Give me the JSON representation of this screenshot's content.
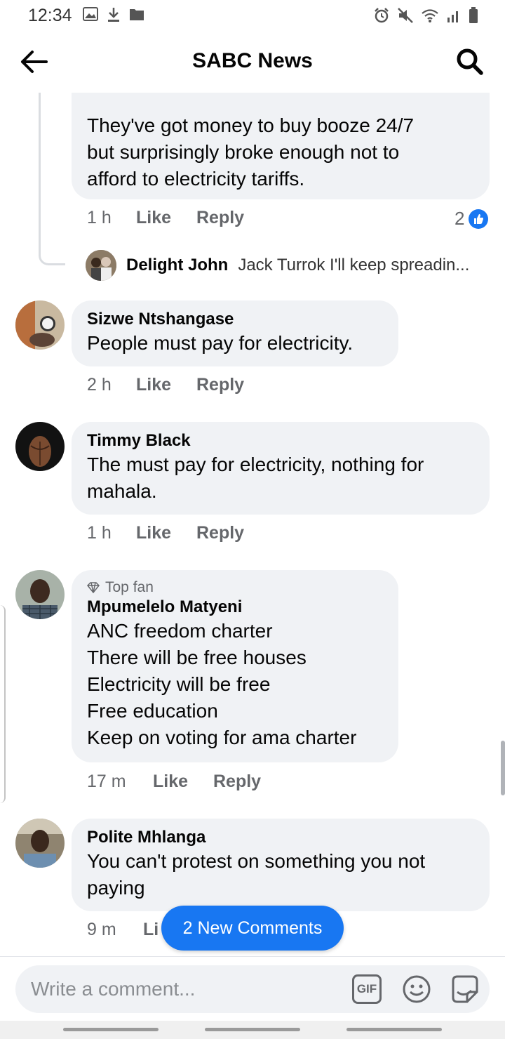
{
  "status_bar": {
    "time": "12:34",
    "left_icons": [
      "image-icon",
      "download-icon",
      "folder-icon"
    ],
    "right_icons": [
      "alarm-icon",
      "mute-icon",
      "wifi-icon",
      "signal-icon",
      "battery-icon"
    ]
  },
  "header": {
    "title": "SABC News"
  },
  "comments": [
    {
      "text": "They've got money to buy booze 24/7\nbut surprisingly broke enough not to\nafford to electricity tariffs.",
      "time": "1 h",
      "like_label": "Like",
      "reply_label": "Reply",
      "reaction_count": "2",
      "reply_preview": {
        "name": "Delight John",
        "text": "Jack Turrok  I'll keep spreadin..."
      }
    },
    {
      "name": "Sizwe Ntshangase",
      "text": "People must pay for electricity.",
      "time": "2 h",
      "like_label": "Like",
      "reply_label": "Reply"
    },
    {
      "name": "Timmy Black",
      "text": "The must pay for electricity, nothing for\nmahala.",
      "time": "1 h",
      "like_label": "Like",
      "reply_label": "Reply"
    },
    {
      "badge": "Top fan",
      "name": "Mpumelelo Matyeni",
      "text": "ANC freedom charter\nThere will be free houses\nElectricity will be free\nFree education\nKeep on voting for ama charter",
      "time": "17 m",
      "like_label": "Like",
      "reply_label": "Reply"
    },
    {
      "name": "Polite Mhlanga",
      "text": "You can't protest on something you not\npaying",
      "time": "9 m",
      "like_label": "Li"
    }
  ],
  "new_comments_button": "2 New Comments",
  "composer": {
    "placeholder": "Write a comment...",
    "gif_label": "GIF"
  },
  "colors": {
    "accent": "#1877f2",
    "bubble": "#f0f2f5",
    "meta_text": "#65676b"
  }
}
